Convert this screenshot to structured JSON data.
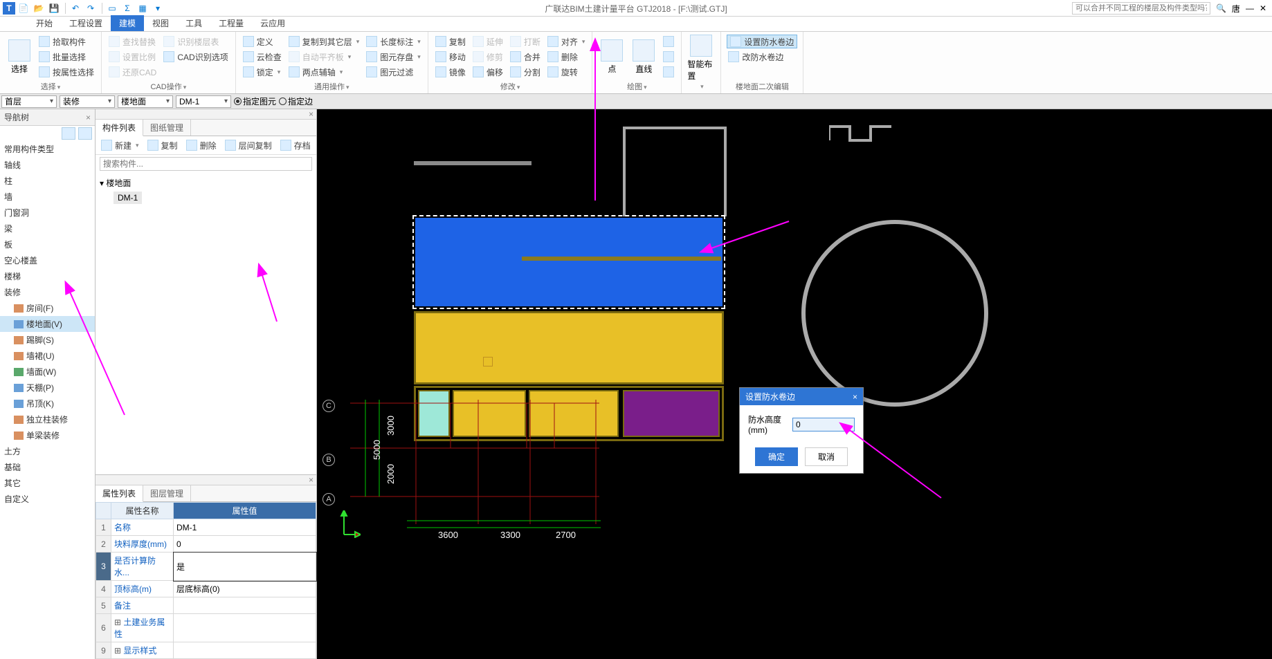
{
  "window": {
    "title": "广联达BIM土建计量平台 GTJ2018 - [F:\\测试.GTJ]",
    "search_placeholder": "可以合并不同工程的楼层及构件类型吗？",
    "search_icon": "🔍",
    "user": "唐"
  },
  "ribbon_tabs": [
    "开始",
    "工程设置",
    "建模",
    "视图",
    "工具",
    "工程量",
    "云应用"
  ],
  "ribbon_active": 2,
  "ribbon_groups": {
    "select": {
      "label": "选择",
      "big": "选择",
      "items": [
        "拾取构件",
        "批量选择",
        "按属性选择"
      ]
    },
    "cad": {
      "label": "CAD操作",
      "items_col1": [
        "查找替换",
        "设置比例",
        "还原CAD"
      ],
      "items_col2": [
        "识别楼层表",
        "CAD识别选项"
      ]
    },
    "general": {
      "label": "通用操作",
      "col1": [
        "定义",
        "云检查",
        "锁定"
      ],
      "col2": [
        "复制到其它层",
        "自动平齐板",
        "两点辅轴"
      ],
      "col3": [
        "长度标注",
        "图元存盘",
        "图元过滤"
      ]
    },
    "modify": {
      "label": "修改",
      "col1": [
        "复制",
        "移动",
        "镜像"
      ],
      "col2": [
        "延伸",
        "修剪",
        "偏移"
      ],
      "col3": [
        "打断",
        "合并",
        "分割"
      ],
      "col4": [
        "对齐",
        "删除",
        "旋转"
      ]
    },
    "draw": {
      "label": "绘图",
      "big1": "点",
      "big2": "直线"
    },
    "smart": {
      "label": "",
      "big": "智能布置"
    },
    "secondary": {
      "label": "楼地面二次编辑",
      "items": [
        "设置防水卷边",
        "改防水卷边"
      ]
    }
  },
  "filterbar": {
    "floor": "首层",
    "category": "装修",
    "type": "楼地面",
    "member": "DM-1",
    "radio1": "指定图元",
    "radio2": "指定边"
  },
  "navtree": {
    "title": "导航树",
    "items": [
      {
        "l": 1,
        "t": "常用构件类型"
      },
      {
        "l": 1,
        "t": "轴线"
      },
      {
        "l": 1,
        "t": "柱"
      },
      {
        "l": 1,
        "t": "墙"
      },
      {
        "l": 1,
        "t": "门窗洞"
      },
      {
        "l": 1,
        "t": "梁"
      },
      {
        "l": 1,
        "t": "板"
      },
      {
        "l": 1,
        "t": "空心楼盖"
      },
      {
        "l": 1,
        "t": "楼梯"
      },
      {
        "l": 1,
        "t": "装修"
      },
      {
        "l": 2,
        "t": "房间(F)",
        "icon": "#d99060"
      },
      {
        "l": 2,
        "t": "楼地面(V)",
        "sel": true,
        "icon": "#6aa0d8"
      },
      {
        "l": 2,
        "t": "踢脚(S)",
        "icon": "#d99060"
      },
      {
        "l": 2,
        "t": "墙裙(U)",
        "icon": "#d99060"
      },
      {
        "l": 2,
        "t": "墙面(W)",
        "icon": "#5aa86b"
      },
      {
        "l": 2,
        "t": "天棚(P)",
        "icon": "#6aa0d8"
      },
      {
        "l": 2,
        "t": "吊顶(K)",
        "icon": "#6aa0d8"
      },
      {
        "l": 2,
        "t": "独立柱装修",
        "icon": "#d99060"
      },
      {
        "l": 2,
        "t": "单梁装修",
        "icon": "#d99060"
      },
      {
        "l": 1,
        "t": "土方"
      },
      {
        "l": 1,
        "t": "基础"
      },
      {
        "l": 1,
        "t": "其它"
      },
      {
        "l": 1,
        "t": "自定义"
      }
    ]
  },
  "complist": {
    "tabs": [
      "构件列表",
      "图纸管理"
    ],
    "toolbar": [
      "新建",
      "复制",
      "删除",
      "层间复制",
      "存档"
    ],
    "search_placeholder": "搜索构件...",
    "root": "楼地面",
    "child": "DM-1"
  },
  "props": {
    "tabs": [
      "属性列表",
      "图层管理"
    ],
    "headers": [
      "属性名称",
      "属性值"
    ],
    "rows": [
      {
        "n": "1",
        "name": "名称",
        "val": "DM-1"
      },
      {
        "n": "2",
        "name": "块料厚度(mm)",
        "val": "0"
      },
      {
        "n": "3",
        "name": "是否计算防水...",
        "val": "是",
        "sel": true
      },
      {
        "n": "4",
        "name": "顶标高(m)",
        "val": "层底标高(0)"
      },
      {
        "n": "5",
        "name": "备注",
        "val": ""
      },
      {
        "n": "6",
        "name": "土建业务属性",
        "val": "",
        "exp": true
      },
      {
        "n": "9",
        "name": "显示样式",
        "val": "",
        "exp": true
      }
    ]
  },
  "dialog": {
    "title": "设置防水卷边",
    "label": "防水高度(mm)",
    "value": "0",
    "ok": "确定",
    "cancel": "取消"
  },
  "dims": {
    "v1": "3000",
    "v2": "2000",
    "v_outer": "5000",
    "h1": "3600",
    "h2": "3300",
    "h3": "2700"
  },
  "axes": {
    "a": "A",
    "b": "B",
    "c": "C"
  }
}
